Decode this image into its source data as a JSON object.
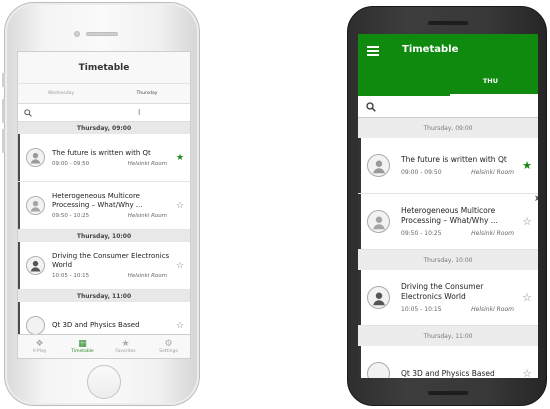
{
  "colors": {
    "accent": "#0f8a0f",
    "ios_tint": "#2a8a2a"
  },
  "ios": {
    "title": "Timetable",
    "tabs": [
      {
        "label": "Wednesday",
        "active": false
      },
      {
        "label": "Thursday",
        "active": true
      }
    ],
    "search_icon": "search-icon",
    "sections": [
      {
        "header": "Thursday, 09:00",
        "sessions": [
          {
            "title": "The future is written with Qt",
            "time": "09:00 - 09:50",
            "room": "Helsinki Room",
            "favorite": true
          },
          {
            "title": "Heterogeneous Multicore Processing – What/Why ...",
            "time": "09:50 - 10:25",
            "room": "Helsinki Room",
            "favorite": false
          }
        ]
      },
      {
        "header": "Thursday, 10:00",
        "sessions": [
          {
            "title": "Driving the Consumer Electronics World",
            "time": "10:05 - 10:15",
            "room": "Helsinki Room",
            "favorite": false
          }
        ]
      },
      {
        "header": "Thursday, 11:00",
        "sessions": [
          {
            "title": "Qt 3D and Physics Based",
            "time": "",
            "room": "",
            "favorite": false
          }
        ]
      }
    ],
    "tabbar": [
      {
        "label": "V-Play",
        "icon": "vplay-icon",
        "active": false
      },
      {
        "label": "Timetable",
        "icon": "calendar-icon",
        "active": true
      },
      {
        "label": "Favorites",
        "icon": "star-icon",
        "active": false
      },
      {
        "label": "Settings",
        "icon": "gear-icon",
        "active": false
      }
    ]
  },
  "android": {
    "title": "Timetable",
    "menu_icon": "hamburger-menu-icon",
    "tab_label": "THU",
    "search_icon": "search-icon",
    "sections": [
      {
        "header": "Thursday, 09:00",
        "sessions": [
          {
            "title": "The future is written with Qt",
            "time": "09:00 - 09:50",
            "room": "Helsinki Room",
            "favorite": true
          },
          {
            "title": "Heterogeneous Multicore Processing – What/Why ...",
            "time": "09:50 - 10:25",
            "room": "Helsinki Room",
            "favorite": false
          }
        ]
      },
      {
        "header": "Thursday, 10:00",
        "sessions": [
          {
            "title": "Driving the Consumer Electronics World",
            "time": "10:05 - 10:15",
            "room": "Helsinki Room",
            "favorite": false
          }
        ]
      },
      {
        "header": "Thursday, 11:00",
        "sessions": [
          {
            "title": "Qt 3D and Physics Based",
            "time": "",
            "room": "",
            "favorite": false
          }
        ]
      }
    ]
  }
}
